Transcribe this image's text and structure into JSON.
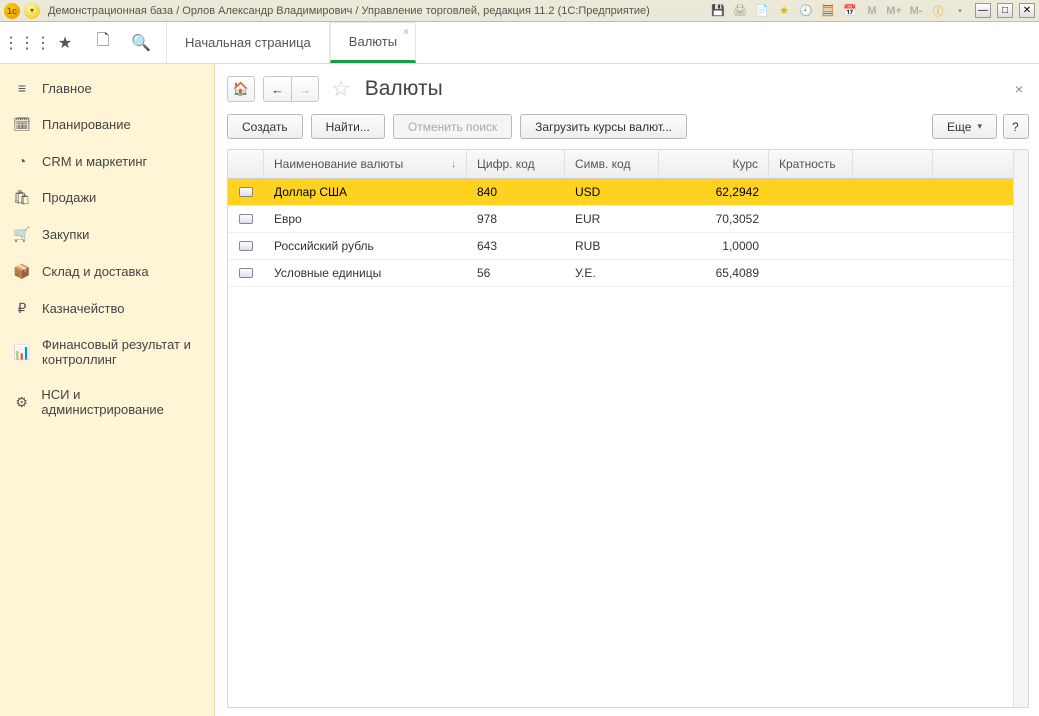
{
  "titlebar": {
    "title": "Демонстрационная база / Орлов Александр Владимирович / Управление торговлей, редакция 11.2  (1С:Предприятие)",
    "mem_m": "M",
    "mem_mp": "M+",
    "mem_mm": "M-"
  },
  "tabs": {
    "home": "Начальная страница",
    "active": "Валюты"
  },
  "sidebar": {
    "items": [
      {
        "icon": "≡",
        "label": "Главное"
      },
      {
        "icon": "🗓",
        "label": "Планирование"
      },
      {
        "icon": "◔",
        "label": "CRM и маркетинг"
      },
      {
        "icon": "🛍",
        "label": "Продажи"
      },
      {
        "icon": "🛒",
        "label": "Закупки"
      },
      {
        "icon": "📦",
        "label": "Склад и доставка"
      },
      {
        "icon": "₽",
        "label": "Казначейство"
      },
      {
        "icon": "📊",
        "label": "Финансовый результат и контроллинг"
      },
      {
        "icon": "⚙",
        "label": "НСИ и администрирование"
      }
    ]
  },
  "page": {
    "title": "Валюты"
  },
  "toolbar": {
    "create": "Создать",
    "find": "Найти...",
    "cancel_find": "Отменить поиск",
    "load_rates": "Загрузить курсы валют...",
    "more": "Еще",
    "help": "?"
  },
  "grid": {
    "columns": {
      "name": "Наименование валюты",
      "num": "Цифр. код",
      "sym": "Симв. код",
      "rate": "Курс",
      "mult": "Кратность"
    },
    "rows": [
      {
        "name": "Доллар США",
        "num": "840",
        "sym": "USD",
        "rate": "62,2942",
        "selected": true
      },
      {
        "name": "Евро",
        "num": "978",
        "sym": "EUR",
        "rate": "70,3052"
      },
      {
        "name": "Российский рубль",
        "num": "643",
        "sym": "RUB",
        "rate": "1,0000"
      },
      {
        "name": "Условные единицы",
        "num": "56",
        "sym": "У.Е.",
        "rate": "65,4089"
      }
    ]
  }
}
